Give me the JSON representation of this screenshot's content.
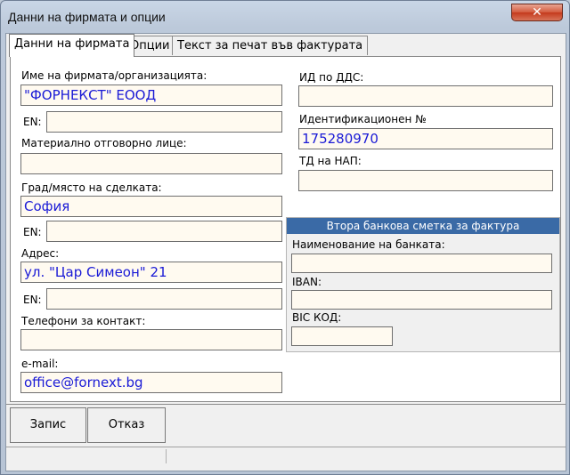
{
  "window": {
    "title": "Данни на фирмата и опции",
    "close_label": "✕"
  },
  "tabs": [
    {
      "label": "Данни на фирмата"
    },
    {
      "label": "Опции"
    },
    {
      "label": "Текст за печат във фактурата"
    }
  ],
  "left": {
    "company_name_label": "Име на фирмата/организацията:",
    "company_name_value": "\"ФОРНЕКСТ\" ЕООД",
    "company_name_en_label": "EN:",
    "company_name_en_value": "",
    "mol_label": "Материално отговорно лице:",
    "mol_value": "",
    "city_label": "Град/място на сделката:",
    "city_value": "София",
    "city_en_label": "EN:",
    "city_en_value": "",
    "address_label": "Адрес:",
    "address_value": "ул. \"Цар Симеон\" 21",
    "address_en_label": "EN:",
    "address_en_value": "",
    "phones_label": "Телефони за контакт:",
    "phones_value": "",
    "email_label": "e-mail:",
    "email_value": "office@fornext.bg"
  },
  "right": {
    "vat_label": "ИД по ДДС:",
    "vat_value": "",
    "id_label": "Идентификационен №",
    "id_value": "175280970",
    "nap_label": "ТД на НАП:",
    "nap_value": ""
  },
  "bank": {
    "header": "Втора банкова сметка за фактура",
    "bank_name_label": "Наименование на банката:",
    "bank_name_value": "",
    "iban_label": "IBAN:",
    "iban_value": "",
    "bic_label": "BIC КОД:",
    "bic_value": ""
  },
  "buttons": {
    "save_label": "Запис",
    "cancel_label": "Отказ"
  }
}
